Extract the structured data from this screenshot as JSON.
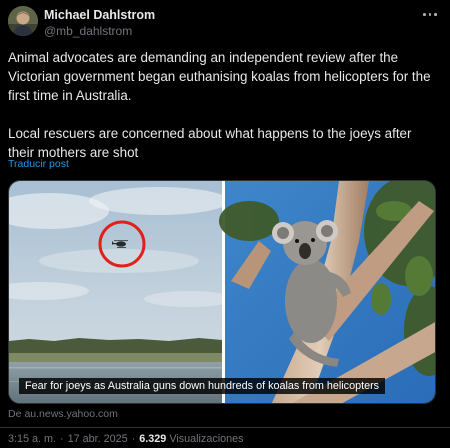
{
  "author": {
    "name": "Michael Dahlstrom",
    "handle": "@mb_dahlstrom"
  },
  "tweet": {
    "paragraphs": [
      "Animal advocates are demanding an independent review after the Victorian government began euthanising koalas from helicopters for the first time in Australia.",
      "Local rescuers are concerned about what happens to the joeys after their mothers are shot"
    ],
    "translate_label": "Traducir post"
  },
  "media": {
    "caption": "Fear for joeys as Australia guns down hundreds of koalas from helicopters",
    "source_prefix": "De",
    "source_domain": "au.news.yahoo.com"
  },
  "meta": {
    "time": "3:15 a. m.",
    "separator": "·",
    "date": "17 abr. 2025",
    "views_count": "6.329",
    "views_label": "Visualizaciones"
  },
  "icons": {
    "more": "more-horizontal-icon"
  },
  "colors": {
    "background": "#000000",
    "text": "#e7e9ea",
    "secondary": "#71767b",
    "link": "#1d9bf0",
    "highlight_circle": "#e0201a"
  }
}
